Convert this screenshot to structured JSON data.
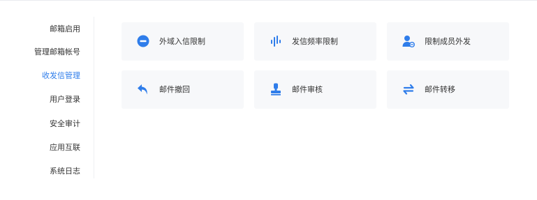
{
  "sidebar": {
    "items": [
      {
        "label": "邮箱启用"
      },
      {
        "label": "管理邮箱帐号"
      },
      {
        "label": "收发信管理",
        "active": true
      },
      {
        "label": "用户登录"
      },
      {
        "label": "安全审计"
      },
      {
        "label": "应用互联"
      },
      {
        "label": "系统日志"
      }
    ]
  },
  "cards": [
    {
      "label": "外域入信限制",
      "icon": "minus-circle-icon"
    },
    {
      "label": "发信频率限制",
      "icon": "frequency-bars-icon"
    },
    {
      "label": "限制成员外发",
      "icon": "user-blocked-icon"
    },
    {
      "label": "邮件撤回",
      "icon": "undo-arrow-icon"
    },
    {
      "label": "邮件审核",
      "icon": "stamp-icon"
    },
    {
      "label": "邮件转移",
      "icon": "transfer-arrows-icon"
    }
  ],
  "colors": {
    "accent": "#2f7dea",
    "card_bg": "#f7f8fa",
    "text": "#333333"
  }
}
